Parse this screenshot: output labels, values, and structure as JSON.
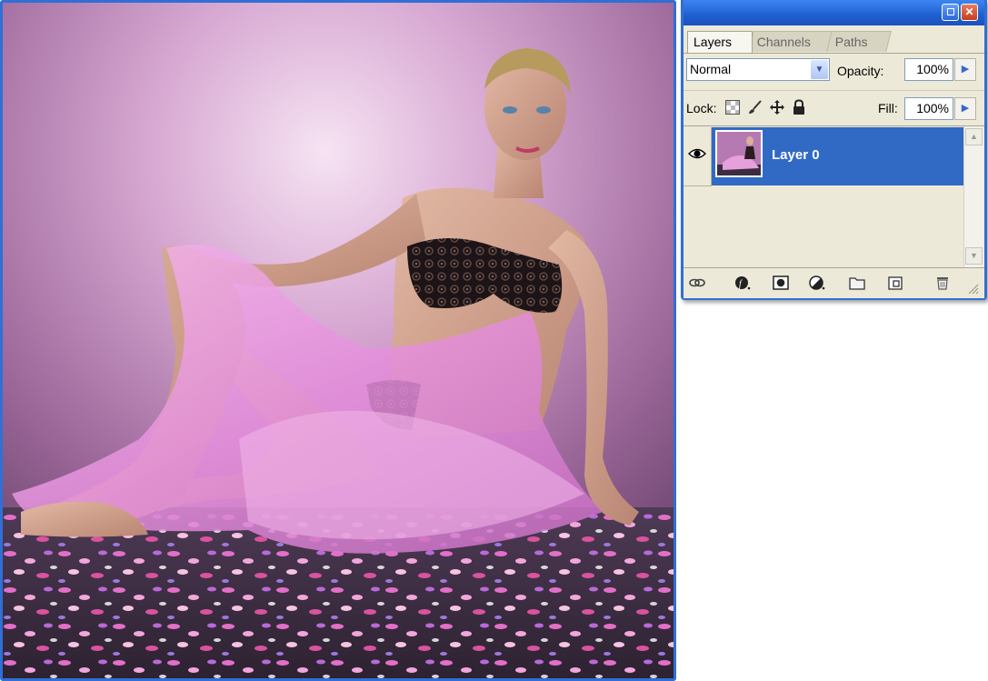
{
  "document": {
    "image_description_icon": "canvas-artwork"
  },
  "layers_panel": {
    "tabs": [
      {
        "label": "Layers",
        "active": true
      },
      {
        "label": "Channels",
        "active": false
      },
      {
        "label": "Paths",
        "active": false
      }
    ],
    "blend_mode": "Normal",
    "opacity_label": "Opacity:",
    "opacity_value": "100%",
    "lock_label": "Lock:",
    "fill_label": "Fill:",
    "fill_value": "100%",
    "layers": [
      {
        "name": "Layer 0",
        "visible": true,
        "selected": true
      }
    ],
    "footer_icons": [
      "link-icon",
      "layer-style-icon",
      "layer-mask-icon",
      "adjustment-layer-icon",
      "new-group-icon",
      "new-layer-icon",
      "trash-icon"
    ]
  },
  "colors": {
    "window_border": "#2f6fd6",
    "panel_bg": "#ece9d8",
    "selection": "#316ac5"
  }
}
